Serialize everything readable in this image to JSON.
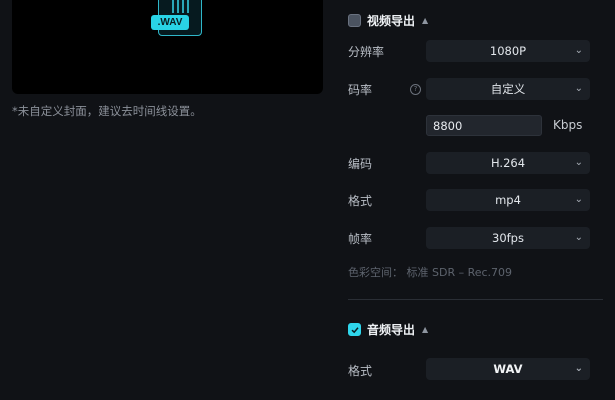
{
  "preview": {
    "file_tag": ".WAV",
    "cover_note": "*未自定义封面，建议去时间线设置。"
  },
  "video_export": {
    "title": "视频导出",
    "checked": false,
    "resolution": {
      "label": "分辨率",
      "value": "1080P"
    },
    "bitrate": {
      "label": "码率",
      "value": "自定义",
      "custom_value": "8800",
      "unit": "Kbps"
    },
    "codec": {
      "label": "编码",
      "value": "H.264"
    },
    "format": {
      "label": "格式",
      "value": "mp4"
    },
    "framerate": {
      "label": "帧率",
      "value": "30fps"
    },
    "color_space": "色彩空间： 标准 SDR – Rec.709"
  },
  "audio_export": {
    "title": "音频导出",
    "checked": true,
    "format": {
      "label": "格式",
      "value": "WAV"
    }
  },
  "colors": {
    "accent": "#2fd6ec",
    "background": "#101216",
    "select_bg": "#1b1f25"
  }
}
